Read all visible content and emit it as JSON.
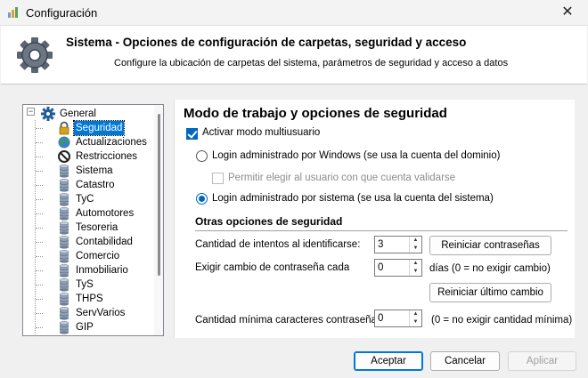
{
  "window": {
    "title": "Configuración",
    "close_glyph": "✕"
  },
  "header": {
    "title": "Sistema - Opciones de configuración de carpetas, seguridad y acceso",
    "subtitle": "Configure la ubicación de carpetas del sistema, parámetros de seguridad y acceso a datos"
  },
  "tree": {
    "expander": "−",
    "root": {
      "label": "General",
      "icon": "gear-icon"
    },
    "items": [
      {
        "label": "Seguridad",
        "icon": "lock-icon",
        "selected": true
      },
      {
        "label": "Actualizaciones",
        "icon": "globe-icon"
      },
      {
        "label": "Restricciones",
        "icon": "no-entry-icon"
      },
      {
        "label": "Sistema",
        "icon": "database-icon"
      },
      {
        "label": "Catastro",
        "icon": "database-icon"
      },
      {
        "label": "TyC",
        "icon": "database-icon"
      },
      {
        "label": "Automotores",
        "icon": "database-icon"
      },
      {
        "label": "Tesoreria",
        "icon": "database-icon"
      },
      {
        "label": "Contabilidad",
        "icon": "database-icon"
      },
      {
        "label": "Comercio",
        "icon": "database-icon"
      },
      {
        "label": "Inmobiliario",
        "icon": "database-icon"
      },
      {
        "label": "TyS",
        "icon": "database-icon"
      },
      {
        "label": "THPS",
        "icon": "database-icon"
      },
      {
        "label": "ServVarios",
        "icon": "database-icon"
      },
      {
        "label": "GIP",
        "icon": "database-icon"
      }
    ]
  },
  "panel": {
    "title": "Modo de trabajo y opciones de seguridad",
    "multiuser": {
      "label": "Activar modo multiusuario",
      "checked": true
    },
    "login_windows": {
      "label": "Login administrado por Windows (se usa la cuenta del dominio)",
      "selected": false
    },
    "allow_user": {
      "label": "Permitir elegir al usuario con que cuenta validarse",
      "checked": false,
      "enabled": false
    },
    "login_system": {
      "label": "Login administrado por sistema (se usa la cuenta del sistema)",
      "selected": true
    },
    "other_title": "Otras opciones de seguridad",
    "attempts": {
      "label": "Cantidad de intentos al identificarse:",
      "value": "3",
      "button": "Reiniciar contraseñas"
    },
    "change": {
      "label": "Exigir cambio de contraseña cada",
      "value": "0",
      "suffix": "días (0 = no exigir cambio)",
      "button": "Reiniciar último cambio"
    },
    "min_chars": {
      "label": "Cantidad mínima caracteres contraseña:",
      "value": "0",
      "suffix": "(0 = no exigir cantidad mínima)"
    }
  },
  "footer": {
    "accept": "Aceptar",
    "cancel": "Cancelar",
    "apply": "Aplicar"
  },
  "colors": {
    "accent": "#0078d7",
    "check": "#0067c0"
  }
}
